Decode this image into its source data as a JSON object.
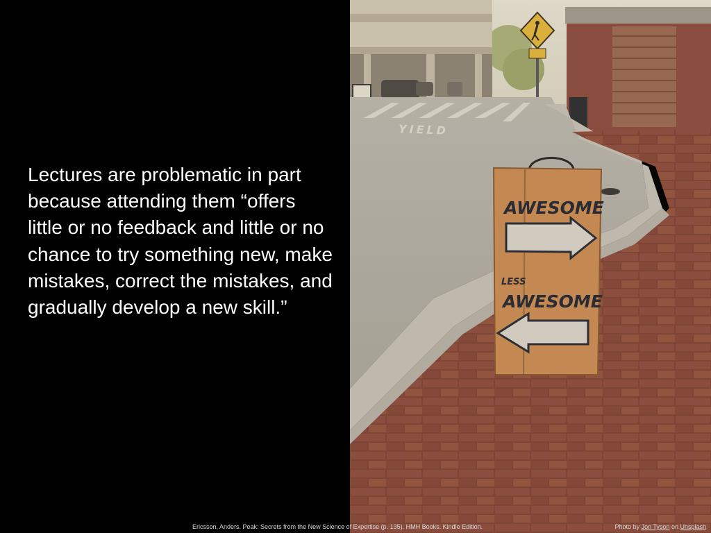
{
  "slide": {
    "quote": "Lectures are problematic in part because attending them “offers little or no feedback and little or no chance to try something new, make mistakes, correct the mistakes, and gradually develop a new skill.”"
  },
  "photo": {
    "road_marking": "YIELD",
    "sign_top": "AWESOME",
    "sign_small": "LESS",
    "sign_bottom": "AWESOME"
  },
  "citation": {
    "reference": "Ericsson, Anders. Peak: Secrets from the New Science of Expertise (p. 135). HMH Books. Kindle Edition.",
    "photo_prefix": "Photo by ",
    "photographer": "Jon Tyson",
    "photo_mid": " on ",
    "source": "Unsplash"
  },
  "colors": {
    "background": "#000000",
    "text": "#ffffff",
    "brick": "#8a4a3c",
    "board": "#c98d55"
  }
}
